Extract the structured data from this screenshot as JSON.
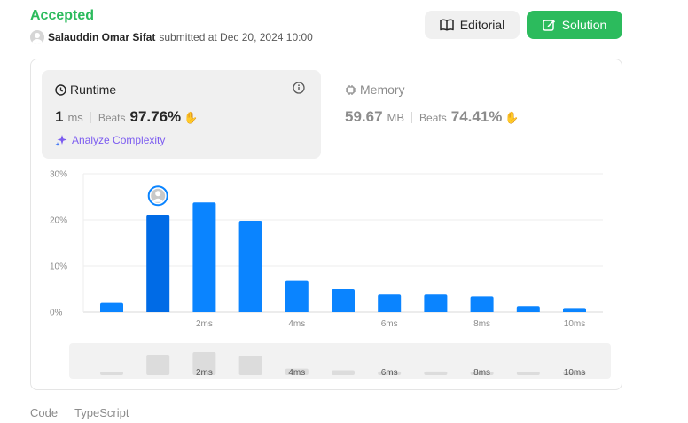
{
  "header": {
    "status": "Accepted",
    "submitter_name": "Salauddin Omar Sifat",
    "submitted_text": "submitted at Dec 20, 2024 10:00",
    "editorial_label": "Editorial",
    "solution_label": "Solution",
    "status_color": "#2cbb5d"
  },
  "runtime": {
    "title": "Runtime",
    "value": "1",
    "unit": "ms",
    "beats_label": "Beats",
    "beats_pct": "97.76%",
    "analyze_label": "Analyze Complexity"
  },
  "memory": {
    "title": "Memory",
    "value": "59.67",
    "unit": "MB",
    "beats_label": "Beats",
    "beats_pct": "74.41%"
  },
  "chart_data": {
    "type": "bar",
    "title": "",
    "xlabel": "",
    "ylabel": "",
    "ylim": [
      0,
      30
    ],
    "yticks": [
      "0%",
      "10%",
      "20%",
      "30%"
    ],
    "x": [
      0,
      1,
      2,
      3,
      4,
      5,
      6,
      7,
      8,
      9,
      10
    ],
    "xtick_labels": {
      "2": "2ms",
      "4": "4ms",
      "6": "6ms",
      "8": "8ms",
      "10": "10ms"
    },
    "values": [
      2.0,
      21.0,
      23.8,
      19.8,
      6.8,
      5.0,
      3.8,
      3.8,
      3.4,
      1.3,
      0.9
    ],
    "highlight_index": 1,
    "colors": {
      "bar": "#0a84ff",
      "highlight": "#006be6",
      "mini_bar": "#e5e5e5"
    }
  },
  "footer": {
    "code_label": "Code",
    "language": "TypeScript"
  }
}
